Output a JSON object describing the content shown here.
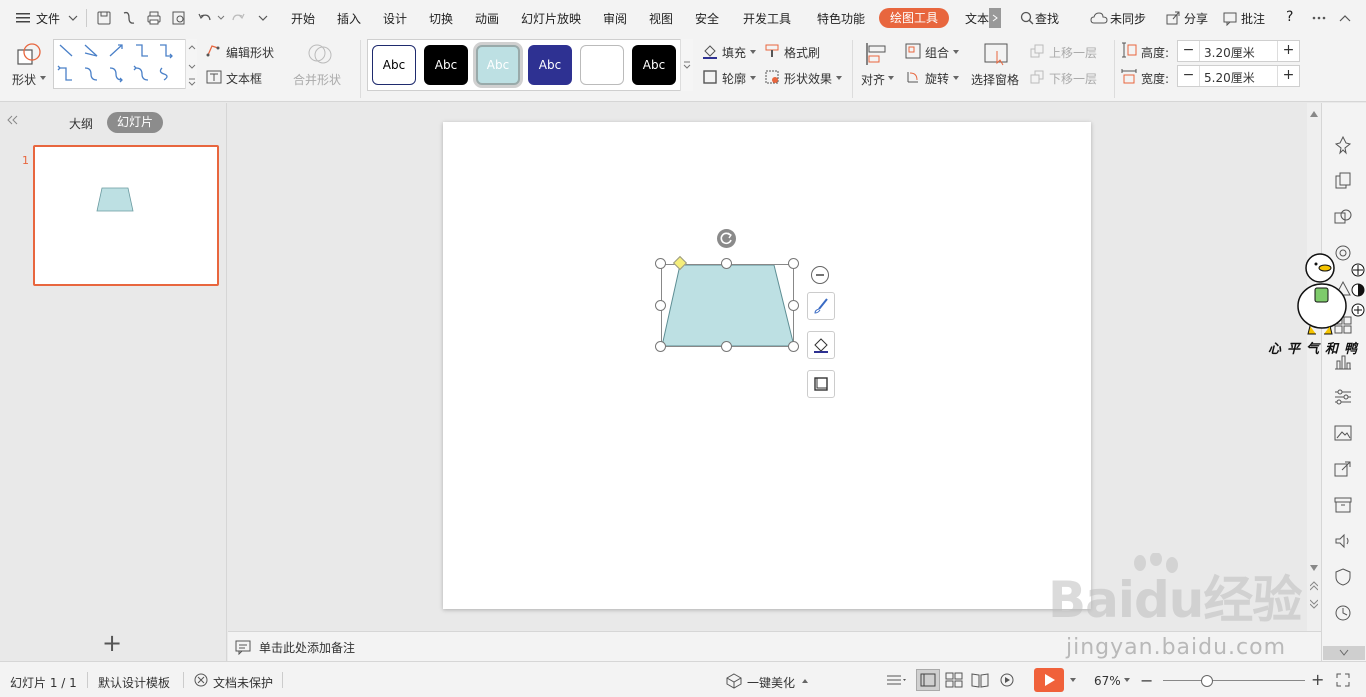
{
  "menu": {
    "file": "文件",
    "tabs": [
      "开始",
      "插入",
      "设计",
      "切换",
      "动画",
      "幻灯片放映",
      "审阅",
      "视图",
      "安全",
      "开发工具",
      "特色功能"
    ],
    "active_tab": "绘图工具",
    "more_tab": "文本",
    "search": "查找",
    "sync": "未同步",
    "share": "分享",
    "comment": "批注",
    "help": "?"
  },
  "ribbon": {
    "shape": "形状",
    "edit_shape": "编辑形状",
    "text_box": "文本框",
    "merge_shape": "合并形状",
    "style_samples": [
      "Abc",
      "Abc",
      "Abc",
      "Abc",
      "",
      "Abc"
    ],
    "fill": "填充",
    "format_brush": "格式刷",
    "outline": "轮廓",
    "shape_effect": "形状效果",
    "align": "对齐",
    "group": "组合",
    "rotate": "旋转",
    "selection_pane": "选择窗格",
    "bring_forward": "上移一层",
    "send_backward": "下移一层",
    "height_label": "高度:",
    "height_value": "3.20厘米",
    "width_label": "宽度:",
    "width_value": "5.20厘米"
  },
  "left_panel": {
    "tab_outline": "大纲",
    "tab_slides": "幻灯片",
    "slide_number": "1",
    "add": "+"
  },
  "notes": {
    "placeholder": "单击此处添加备注"
  },
  "status": {
    "slide_info": "幻灯片 1 / 1",
    "template": "默认设计模板",
    "protect": "文档未保护",
    "beautify": "一键美化",
    "zoom": "67%"
  },
  "watermark": {
    "logo_text": "心平气和鸭",
    "baidu": "Baidu经验",
    "url": "jingyan.baidu.com"
  },
  "colors": {
    "accent": "#e8663e",
    "shape_fill": "#bde0e3",
    "play": "#f0613a"
  }
}
